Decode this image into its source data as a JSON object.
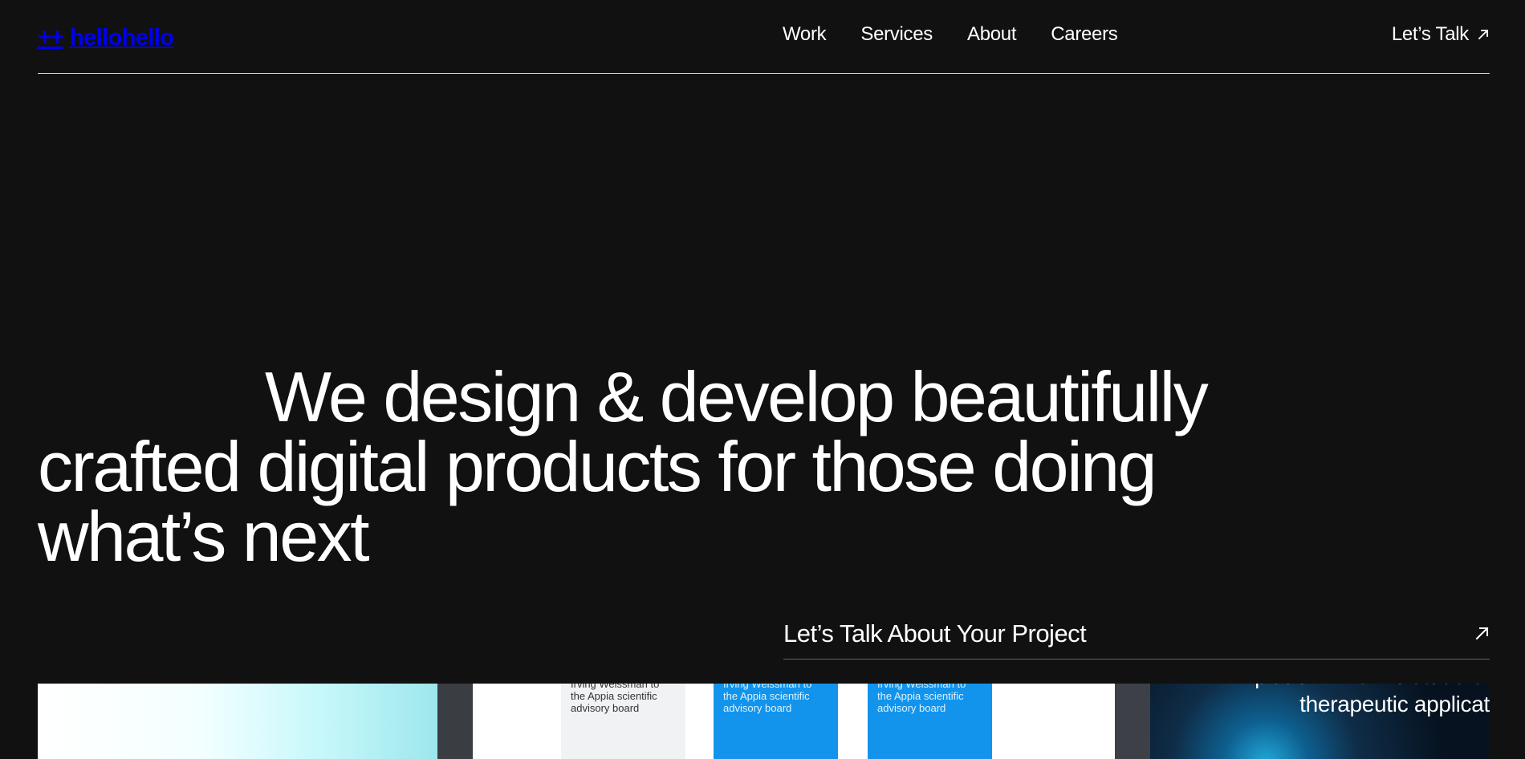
{
  "header": {
    "logo_mark": "++",
    "logo_text": "hellohello",
    "nav": [
      {
        "label": "Work"
      },
      {
        "label": "Services"
      },
      {
        "label": "About"
      },
      {
        "label": "Careers"
      }
    ],
    "cta_label": "Let’s Talk"
  },
  "hero": {
    "line1": "We design & develop beautifully",
    "line2": "crafted digital products for those doing",
    "line3": "what’s next"
  },
  "project_link": {
    "label": "Let’s Talk About Your Project"
  },
  "showcase": {
    "cards": [
      {
        "text": "Irving Weissman to\nthe Appia scientific\nadvisory board"
      },
      {
        "text": "Irving Weissman to\nthe Appia scientific\nadvisory board"
      },
      {
        "text": "Irving Weissman to\nthe Appia scientific\nadvisory board"
      }
    ],
    "right_panel_lines": [
      "platform – a multitude of",
      "therapeutic applicat"
    ]
  },
  "colors": {
    "background": "#111111",
    "text": "#ffffff",
    "accent_blue": "#1294ec"
  },
  "icons": {
    "header_cta": "arrow-up-right-icon",
    "project_link": "arrow-up-right-icon"
  }
}
